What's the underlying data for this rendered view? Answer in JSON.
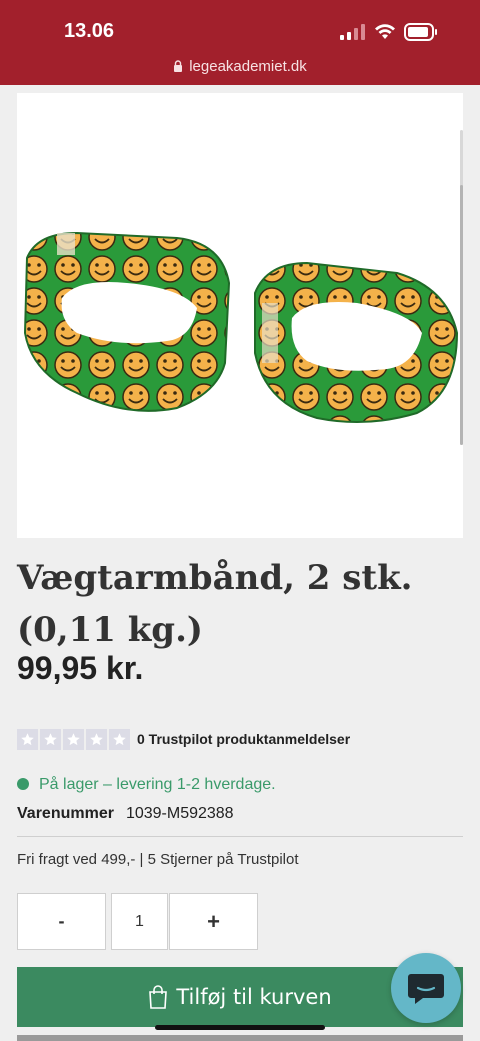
{
  "status_bar": {
    "time": "13.06",
    "url": "legeakademiet.dk"
  },
  "product": {
    "title": "Vægtarmbånd, 2 stk. (0,11 kg.)",
    "price": "99,95 kr.",
    "image_icon": "product-image"
  },
  "trustpilot": {
    "star_count": 5,
    "rating_filled": 0,
    "label": "0 Trustpilot produktanmeldelser"
  },
  "stock": {
    "text": "På lager – levering 1-2 hverdage.",
    "color": "#3a9a6a"
  },
  "sku": {
    "label": "Varenummer",
    "value": "1039-M592388"
  },
  "shipping_text": "Fri fragt ved 499,- | 5 Stjerner på Trustpilot",
  "quantity": {
    "minus_label": "-",
    "value": "1",
    "plus_label": "+"
  },
  "cart": {
    "button_label": "Tilføj til kurven",
    "color": "#3b8a60"
  },
  "colors": {
    "header": "#a2202c",
    "chat": "#64b7c8"
  }
}
